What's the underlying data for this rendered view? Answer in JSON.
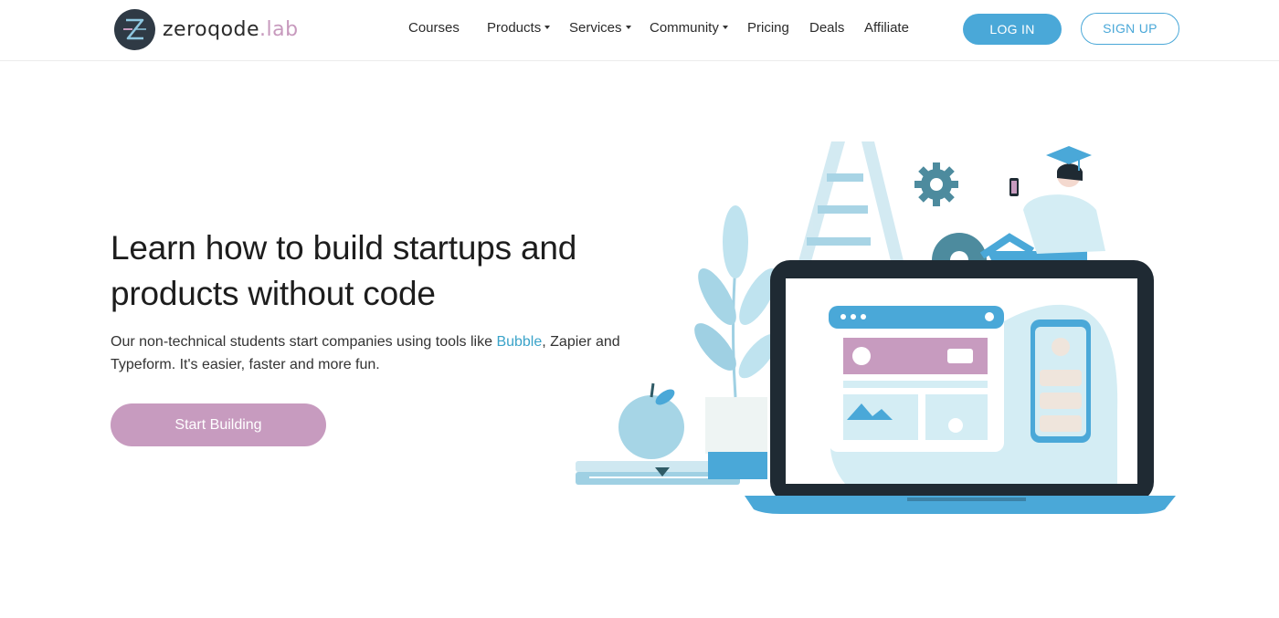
{
  "brand": {
    "name": "zeroqode",
    "suffix": ".lab",
    "accent_color": "#c799bd",
    "primary_color": "#4aa8d8",
    "logo_icon": "zeroqode-logo-icon"
  },
  "nav": {
    "items": [
      {
        "label": "Courses",
        "has_dropdown": false
      },
      {
        "label": "Products",
        "has_dropdown": true
      },
      {
        "label": "Services",
        "has_dropdown": true
      },
      {
        "label": "Community",
        "has_dropdown": true
      },
      {
        "label": "Pricing",
        "has_dropdown": false
      },
      {
        "label": "Deals",
        "has_dropdown": false
      },
      {
        "label": "Affiliate",
        "has_dropdown": false
      }
    ],
    "login_label": "LOG IN",
    "signup_label": "SIGN UP"
  },
  "hero": {
    "title": "Learn how to build startups and products without code",
    "subtitle_before": "Our non-technical students start companies using tools like ",
    "subtitle_link": "Bubble",
    "subtitle_after": ", Zapier and Typeform. It's easier, faster and more fun.",
    "cta_label": "Start Building",
    "cta_color": "#c79bbf"
  },
  "illustration": {
    "description_icon": "laptop-student-illustration-icon"
  }
}
